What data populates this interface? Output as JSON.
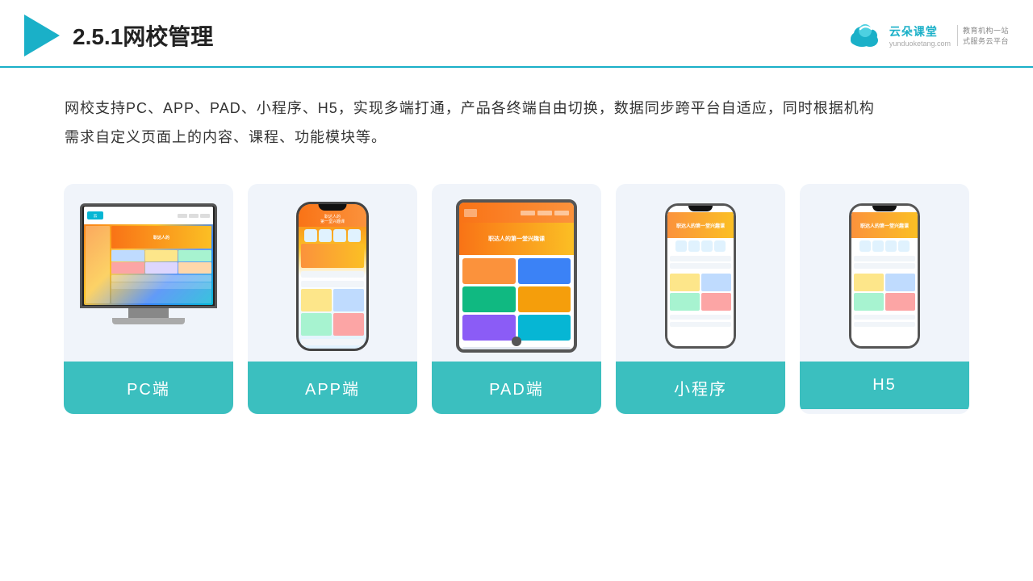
{
  "header": {
    "title": "2.5.1网校管理",
    "brand": {
      "name": "云朵课堂",
      "name_pinyin": "yunduoketang.com",
      "slogan_line1": "教育机构一站",
      "slogan_line2": "式服务云平台"
    }
  },
  "description": {
    "text_line1": "网校支持PC、APP、PAD、小程序、H5，实现多端打通，产品各终端自由切换，数据同步跨平台自适应，同时根据机构",
    "text_line2": "需求自定义页面上的内容、课程、功能模块等。"
  },
  "cards": [
    {
      "id": "pc",
      "label": "PC端",
      "device_type": "pc"
    },
    {
      "id": "app",
      "label": "APP端",
      "device_type": "phone"
    },
    {
      "id": "pad",
      "label": "PAD端",
      "device_type": "tablet"
    },
    {
      "id": "miniprogram",
      "label": "小程序",
      "device_type": "mini-phone"
    },
    {
      "id": "h5",
      "label": "H5",
      "device_type": "mini-phone"
    }
  ],
  "accent_color": "#3bbfbf",
  "border_color": "#1ab0c8"
}
